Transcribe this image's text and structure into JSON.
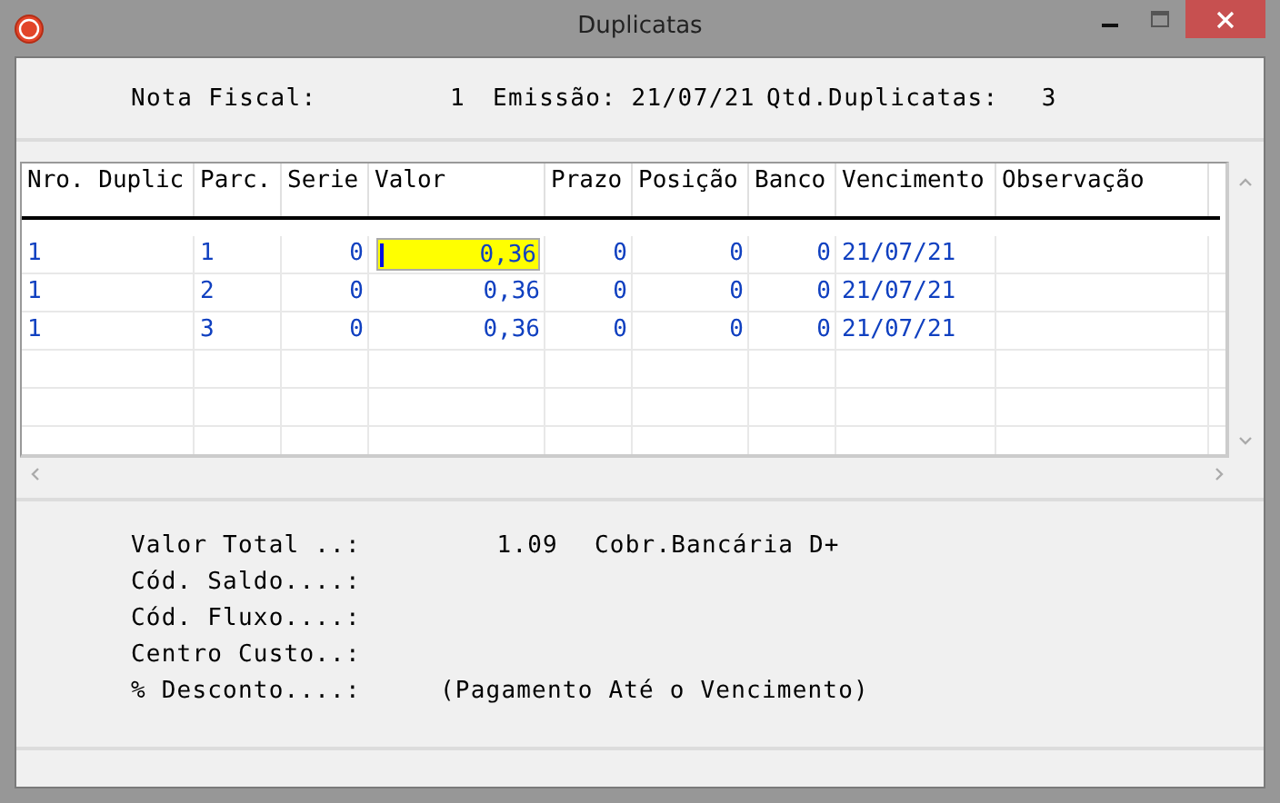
{
  "window": {
    "title": "Duplicatas"
  },
  "header": {
    "nota_fiscal_label": "Nota Fiscal:",
    "nota_fiscal": "1",
    "emissao_label": "Emissão:",
    "emissao": "21/07/21",
    "qtd_label": "Qtd.Duplicatas:",
    "qtd": "3"
  },
  "table": {
    "columns": [
      "Nro. Duplic",
      "Parc.",
      "Serie",
      "Valor",
      "Prazo",
      "Posição",
      "Banco",
      "Vencimento",
      "Observação"
    ],
    "rows": [
      {
        "selected": true,
        "cells": [
          "1",
          "1",
          "0",
          "0,36",
          "0",
          "0",
          "0",
          "21/07/21"
        ]
      },
      {
        "selected": false,
        "cells": [
          "1",
          "2",
          "0",
          "0,36",
          "0",
          "0",
          "0",
          "21/07/21"
        ]
      },
      {
        "selected": false,
        "cells": [
          "1",
          "3",
          "0",
          "0,36",
          "0",
          "0",
          "0",
          "21/07/21"
        ]
      }
    ]
  },
  "summary": [
    {
      "label": "Valor Total ..:",
      "value": "1.09",
      "note": "Cobr.Bancária D+"
    },
    {
      "label": "Cód. Saldo....:"
    },
    {
      "label": "Cód. Fluxo....:"
    },
    {
      "label": "Centro Custo..:"
    },
    {
      "label": "% Desconto....:",
      "note": "(Pagamento Até o Vencimento)"
    }
  ]
}
